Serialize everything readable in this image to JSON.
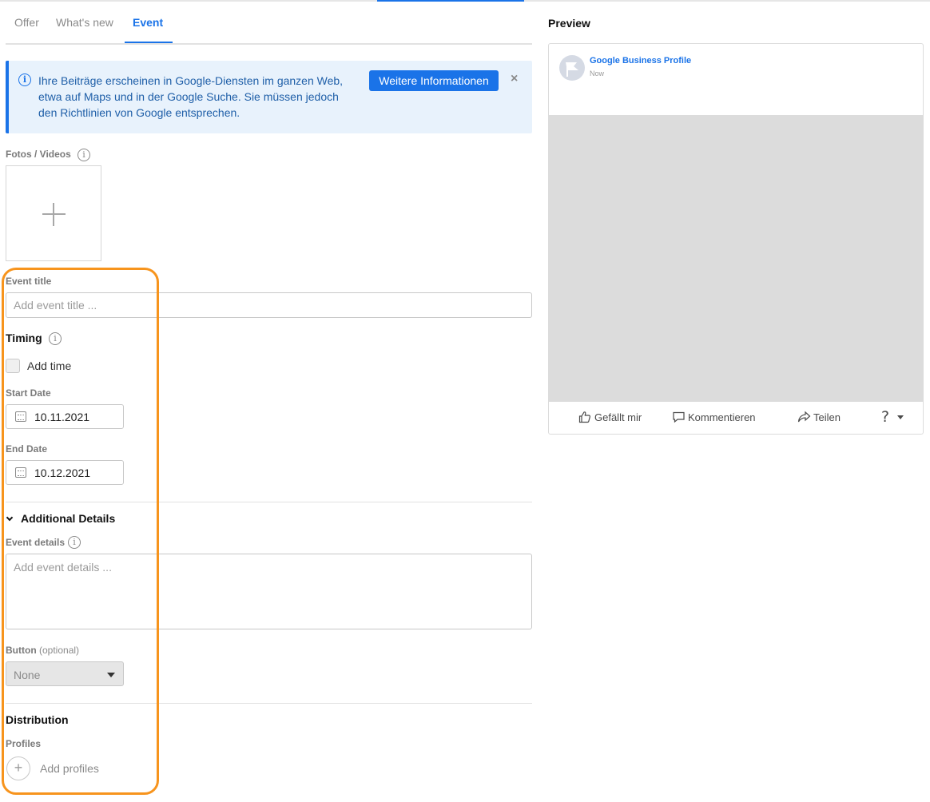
{
  "tabs": [
    {
      "label": "Offer"
    },
    {
      "label": "What's new"
    },
    {
      "label": "Event"
    }
  ],
  "active_tab": "Event",
  "banner": {
    "text": "Ihre Beiträge erscheinen in Google-Diensten im ganzen Web, etwa auf Maps und in der Google Suche. Sie müssen jedoch den Richtlinien von Google entsprechen.",
    "button_label": "Weitere Informationen",
    "close_glyph": "×"
  },
  "media": {
    "label": "Fotos / Videos"
  },
  "event_title": {
    "label": "Event title",
    "placeholder": "Add event title ...",
    "value": ""
  },
  "timing": {
    "title": "Timing",
    "add_time_label": "Add time",
    "add_time_checked": false,
    "start_date_label": "Start Date",
    "start_date_value": "10.11.2021",
    "end_date_label": "End Date",
    "end_date_value": "10.12.2021"
  },
  "additional_details": {
    "title": "Additional Details",
    "event_details_label": "Event details",
    "event_details_placeholder": "Add event details ...",
    "button_label": "Button",
    "button_optional": "(optional)",
    "button_selected": "None"
  },
  "distribution": {
    "title": "Distribution",
    "profiles_label": "Profiles",
    "add_profiles_label": "Add profiles"
  },
  "preview": {
    "title": "Preview",
    "profile_name": "Google Business Profile",
    "time": "Now",
    "actions": [
      {
        "label": "Gefällt mir",
        "icon": "thumbs-up-icon"
      },
      {
        "label": "Kommentieren",
        "icon": "comment-icon"
      },
      {
        "label": "Teilen",
        "icon": "share-icon"
      }
    ],
    "help_glyph": "?"
  },
  "colors": {
    "accent": "#1a73e8",
    "highlight": "#f7941d",
    "banner_bg": "#e8f2fc"
  }
}
